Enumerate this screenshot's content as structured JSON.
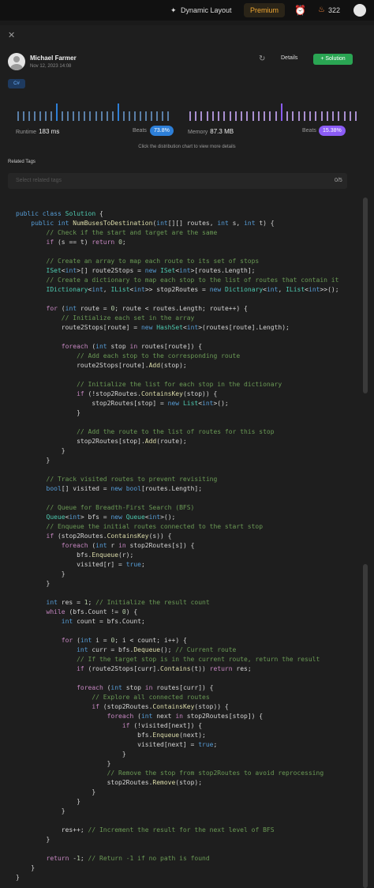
{
  "topbar": {
    "layout_label": "Dynamic Layout",
    "premium_label": "Premium",
    "streak_count": "322"
  },
  "submission": {
    "user_name": "Michael Farmer",
    "date": "Nov 12, 2023 14:08",
    "details_label": "Details",
    "solution_label": "Solution",
    "language": "C#"
  },
  "stats": {
    "runtime_label": "Runtime",
    "runtime_value": "183 ms",
    "runtime_beats_label": "Beats",
    "runtime_beats_value": "73.8%",
    "memory_label": "Memory",
    "memory_value": "87.3 MB",
    "memory_beats_label": "Beats",
    "memory_beats_value": "15.38%",
    "hint": "Click the distribution chart to view more details"
  },
  "tags": {
    "title": "Related Tags",
    "placeholder": "Select related tags",
    "count": "0/5"
  },
  "colors": {
    "accent_green": "#2aa553",
    "runtime_blue": "#2d7fd8",
    "memory_purple": "#8b5cf6",
    "premium_orange": "#f0a732"
  },
  "code": [
    "public class Solution {",
    "    public int NumBusesToDestination(int[][] routes, int s, int t) {",
    "        // Check if the start and target are the same",
    "        if (s == t) return 0;",
    "",
    "        // Create an array to map each route to its set of stops",
    "        ISet<int>[] route2Stops = new ISet<int>[routes.Length];",
    "        // Create a dictionary to map each stop to the list of routes that contain it",
    "        IDictionary<int, IList<int>> stop2Routes = new Dictionary<int, IList<int>>();",
    "",
    "        for (int route = 0; route < routes.Length; route++) {",
    "            // Initialize each set in the array",
    "            route2Stops[route] = new HashSet<int>(routes[route].Length);",
    "",
    "            foreach (int stop in routes[route]) {",
    "                // Add each stop to the corresponding route",
    "                route2Stops[route].Add(stop);",
    "",
    "                // Initialize the list for each stop in the dictionary",
    "                if (!stop2Routes.ContainsKey(stop)) {",
    "                    stop2Routes[stop] = new List<int>();",
    "                }",
    "",
    "                // Add the route to the list of routes for this stop",
    "                stop2Routes[stop].Add(route);",
    "            }",
    "        }",
    "",
    "        // Track visited routes to prevent revisiting",
    "        bool[] visited = new bool[routes.Length];",
    "",
    "        // Queue for Breadth-First Search (BFS)",
    "        Queue<int> bfs = new Queue<int>();",
    "        // Enqueue the initial routes connected to the start stop",
    "        if (stop2Routes.ContainsKey(s)) {",
    "            foreach (int r in stop2Routes[s]) {",
    "                bfs.Enqueue(r);",
    "                visited[r] = true;",
    "            }",
    "        }",
    "",
    "        int res = 1; // Initialize the result count",
    "        while (bfs.Count != 0) {",
    "            int count = bfs.Count;",
    "",
    "            for (int i = 0; i < count; i++) {",
    "                int curr = bfs.Dequeue(); // Current route",
    "                // If the target stop is in the current route, return the result",
    "                if (route2Stops[curr].Contains(t)) return res;",
    "",
    "                foreach (int stop in routes[curr]) {",
    "                    // Explore all connected routes",
    "                    if (stop2Routes.ContainsKey(stop)) {",
    "                        foreach (int next in stop2Routes[stop]) {",
    "                            if (!visited[next]) {",
    "                                bfs.Enqueue(next);",
    "                                visited[next] = true;",
    "                            }",
    "                        }",
    "                        // Remove the stop from stop2Routes to avoid reprocessing",
    "                        stop2Routes.Remove(stop);",
    "                    }",
    "                }",
    "            }",
    "",
    "            res++; // Increment the result for the next level of BFS",
    "        }",
    "",
    "        return -1; // Return -1 if no path is found",
    "    }",
    "}"
  ]
}
